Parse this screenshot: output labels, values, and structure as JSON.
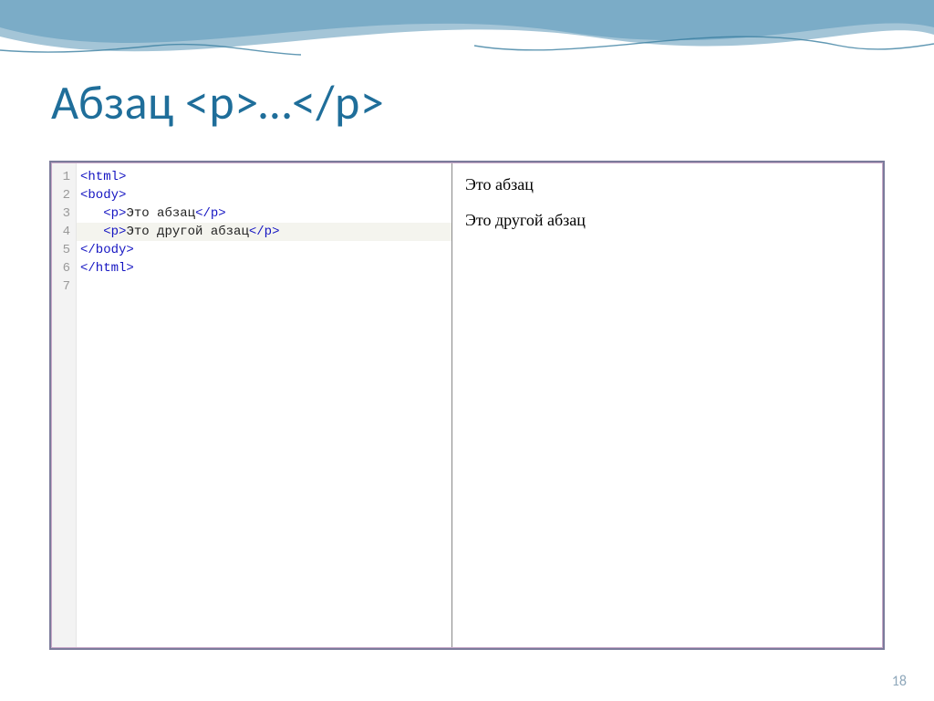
{
  "title": "Абзац  <p>…</p>",
  "page_number": "18",
  "code": {
    "line_numbers": [
      "1",
      "2",
      "3",
      "4",
      "5",
      "6",
      "7"
    ],
    "lines": [
      {
        "indent": "",
        "open_tag": "<html>",
        "text": "",
        "close_tag": "",
        "highlight": false
      },
      {
        "indent": "",
        "open_tag": "<body>",
        "text": "",
        "close_tag": "",
        "highlight": false
      },
      {
        "indent": "   ",
        "open_tag": "<p>",
        "text": "Это абзац",
        "close_tag": "</p>",
        "highlight": false
      },
      {
        "indent": "   ",
        "open_tag": "<p>",
        "text": "Это другой абзац",
        "close_tag": "</p>",
        "highlight": true
      },
      {
        "indent": "",
        "open_tag": "</body>",
        "text": "",
        "close_tag": "",
        "highlight": false
      },
      {
        "indent": "",
        "open_tag": "</html>",
        "text": "",
        "close_tag": "",
        "highlight": false
      },
      {
        "indent": "",
        "open_tag": "",
        "text": "",
        "close_tag": "",
        "highlight": false
      }
    ]
  },
  "preview": {
    "paragraphs": [
      "Это абзац",
      "Это другой абзац"
    ]
  }
}
